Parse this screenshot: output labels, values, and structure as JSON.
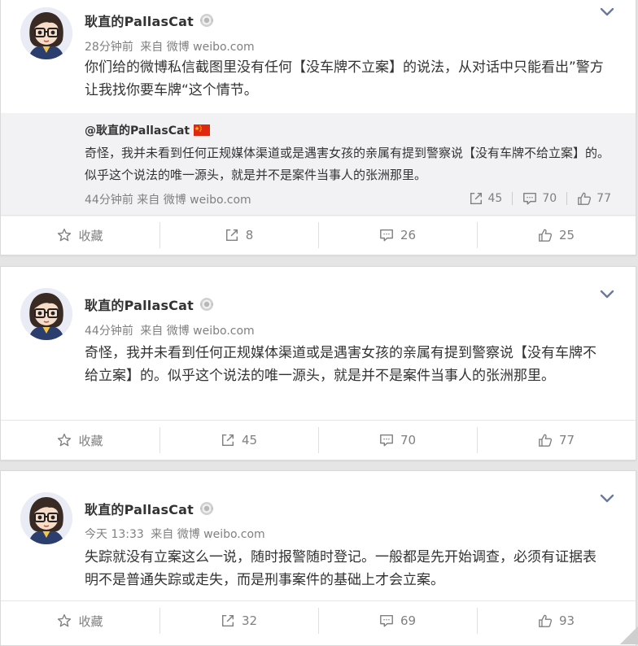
{
  "posts": [
    {
      "author": "耿直的PallasCat",
      "time": "28分钟前",
      "via": "来自",
      "source": "微博 weibo.com",
      "text": "你们给的微博私信截图里没有任何【没车牌不立案】的说法，从对话中只能看出”警方让我找你要车牌“这个情节。",
      "quote": {
        "author": "@耿直的PallasCat",
        "text": "奇怪，我并未看到任何正规媒体渠道或是遇害女孩的亲属有提到警察说【没有车牌不给立案】的。似乎这个说法的唯一源头，就是并不是案件当事人的张洲那里。",
        "time": "44分钟前",
        "via": "来自",
        "source": "微博 weibo.com",
        "reposts": "45",
        "comments": "70",
        "likes": "77"
      },
      "actions": {
        "favorite": "收藏",
        "reposts": "8",
        "comments": "26",
        "likes": "25"
      }
    },
    {
      "author": "耿直的PallasCat",
      "time": "44分钟前",
      "via": "来自",
      "source": "微博 weibo.com",
      "text": "奇怪，我并未看到任何正规媒体渠道或是遇害女孩的亲属有提到警察说【没有车牌不给立案】的。似乎这个说法的唯一源头，就是并不是案件当事人的张洲那里。",
      "actions": {
        "favorite": "收藏",
        "reposts": "45",
        "comments": "70",
        "likes": "77"
      }
    },
    {
      "author": "耿直的PallasCat",
      "time": "今天 13:33",
      "via": "来自",
      "source": "微博 weibo.com",
      "text": "失踪就没有立案这么一说，随时报警随时登记。一般都是先开始调查，必须有证据表明不是普通失踪或走失，而是刑事案件的基础上才会立案。",
      "actions": {
        "favorite": "收藏",
        "reposts": "32",
        "comments": "69",
        "likes": "93"
      }
    }
  ],
  "colors": {
    "accent": "#808080",
    "quote_bg": "#f2f2f5",
    "page_bg": "#e5e5e5"
  },
  "icons": [
    "avatar-catgirl",
    "vip-badge-icon",
    "chevron-down-icon",
    "china-flag-icon",
    "star-icon",
    "share-icon",
    "comment-icon",
    "like-icon"
  ]
}
